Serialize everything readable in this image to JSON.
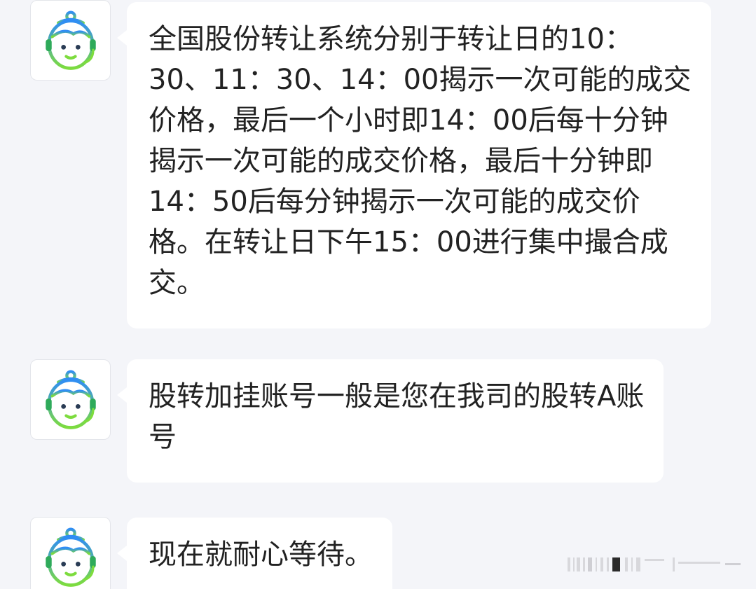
{
  "messages": [
    {
      "sender": "agent",
      "avatar_icon": "agent-avatar-icon",
      "lines": [
        "全国股份转让系统分别于转让日的10：",
        "30、11：30、14：00揭示一次可能的成交",
        "价格，最后一个小时即14：00后每十分钟",
        "揭示一次可能的成交价格，最后十分钟即",
        "14：50后每分钟揭示一次可能的成交价",
        "格。在转让日下午15：00进行集中撮合成",
        "交。"
      ]
    },
    {
      "sender": "agent",
      "avatar_icon": "agent-avatar-icon",
      "lines": [
        "股转加挂账号一般是您在我司的股转A账",
        "号"
      ]
    },
    {
      "sender": "agent",
      "avatar_icon": "agent-avatar-icon",
      "lines": [
        "现在就耐心等待。"
      ]
    }
  ],
  "colors": {
    "background": "#f4f5f9",
    "bubble": "#ffffff",
    "text": "#222222",
    "avatar_gradient_top": "#2f8df5",
    "avatar_gradient_bottom": "#7ddc3e"
  }
}
